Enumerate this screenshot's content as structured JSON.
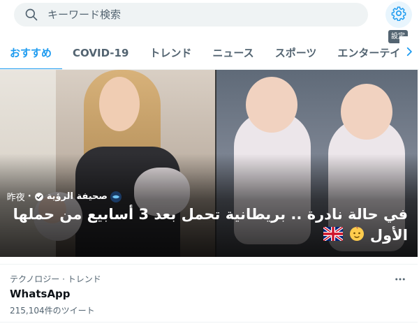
{
  "search": {
    "placeholder": "キーワード検索"
  },
  "settings": {
    "tooltip": "設定"
  },
  "tabs": [
    {
      "label": "おすすめ",
      "active": true
    },
    {
      "label": "COVID-19",
      "active": false
    },
    {
      "label": "トレンド",
      "active": false
    },
    {
      "label": "ニュース",
      "active": false
    },
    {
      "label": "スポーツ",
      "active": false
    },
    {
      "label": "エンターテイ",
      "active": false
    }
  ],
  "hero": {
    "source": "صحيفة الرؤية",
    "time": "昨夜",
    "title_line1": "في حالة نادرة .. بريطانية تحمل بعد 3 أسابيع من حملها",
    "title_line2": "الأول"
  },
  "trend": {
    "category": "テクノロジー · トレンド",
    "name": "WhatsApp",
    "count": "215,104件のツイート"
  },
  "colors": {
    "accent": "#1d9bf0",
    "muted": "#536471",
    "text": "#0f1419"
  }
}
